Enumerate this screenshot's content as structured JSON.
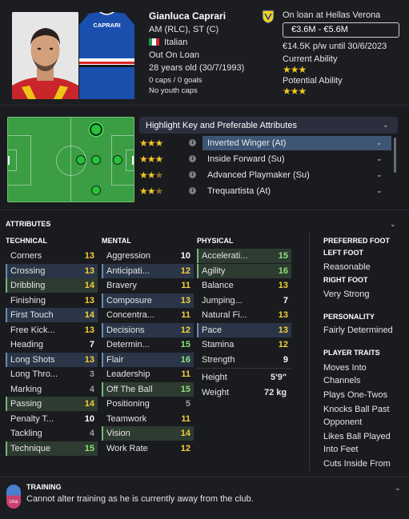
{
  "player": {
    "name": "Gianluca Caprari",
    "positions": "AM (RLC), ST (C)",
    "nationality": "Italian",
    "status": "Out On Loan",
    "age": "28 years old (30/7/1993)",
    "caps": "0 caps / 0 goals",
    "youth": "No youth caps",
    "kit_name": "CAPRARI"
  },
  "contract": {
    "loan": "On loan at Hellas Verona",
    "value": "€3.6M - €5.6M",
    "wage": "€14.5K p/w until 30/6/2023",
    "current_ability_label": "Current Ability",
    "current_ability_stars": 3,
    "potential_ability_label": "Potential Ability",
    "potential_ability_stars": 3
  },
  "roles": {
    "header": "Highlight Key and Preferable Attributes",
    "items": [
      {
        "name": "Inverted Winger (At)",
        "stars": 3
      },
      {
        "name": "Inside Forward (Su)",
        "stars": 3
      },
      {
        "name": "Advanced Playmaker (Su)",
        "stars": 2.5
      },
      {
        "name": "Trequartista (At)",
        "stars": 2.5
      }
    ]
  },
  "attributes": {
    "title": "ATTRIBUTES",
    "technical_label": "TECHNICAL",
    "mental_label": "MENTAL",
    "physical_label": "PHYSICAL",
    "technical": [
      {
        "name": "Corners",
        "value": "13"
      },
      {
        "name": "Crossing",
        "value": "13"
      },
      {
        "name": "Dribbling",
        "value": "14"
      },
      {
        "name": "Finishing",
        "value": "13"
      },
      {
        "name": "First Touch",
        "value": "14"
      },
      {
        "name": "Free Kick...",
        "value": "13"
      },
      {
        "name": "Heading",
        "value": "7"
      },
      {
        "name": "Long Shots",
        "value": "13"
      },
      {
        "name": "Long Thro...",
        "value": "3"
      },
      {
        "name": "Marking",
        "value": "4"
      },
      {
        "name": "Passing",
        "value": "14"
      },
      {
        "name": "Penalty T...",
        "value": "10"
      },
      {
        "name": "Tackling",
        "value": "4"
      },
      {
        "name": "Technique",
        "value": "15"
      }
    ],
    "mental": [
      {
        "name": "Aggression",
        "value": "10"
      },
      {
        "name": "Anticipati...",
        "value": "12"
      },
      {
        "name": "Bravery",
        "value": "11"
      },
      {
        "name": "Composure",
        "value": "13"
      },
      {
        "name": "Concentra...",
        "value": "11"
      },
      {
        "name": "Decisions",
        "value": "12"
      },
      {
        "name": "Determin...",
        "value": "15"
      },
      {
        "name": "Flair",
        "value": "16"
      },
      {
        "name": "Leadership",
        "value": "11"
      },
      {
        "name": "Off The Ball",
        "value": "15"
      },
      {
        "name": "Positioning",
        "value": "5"
      },
      {
        "name": "Teamwork",
        "value": "11"
      },
      {
        "name": "Vision",
        "value": "14"
      },
      {
        "name": "Work Rate",
        "value": "12"
      }
    ],
    "physical": [
      {
        "name": "Accelerati...",
        "value": "15"
      },
      {
        "name": "Agility",
        "value": "16"
      },
      {
        "name": "Balance",
        "value": "13"
      },
      {
        "name": "Jumping...",
        "value": "7"
      },
      {
        "name": "Natural Fi...",
        "value": "13"
      },
      {
        "name": "Pace",
        "value": "13"
      },
      {
        "name": "Stamina",
        "value": "12"
      },
      {
        "name": "Strength",
        "value": "9"
      }
    ],
    "height_label": "Height",
    "height": "5'9\"",
    "weight_label": "Weight",
    "weight": "72 kg"
  },
  "side": {
    "preferred_foot_label": "PREFERRED FOOT",
    "left_foot_label": "LEFT FOOT",
    "left_foot": "Reasonable",
    "right_foot_label": "RIGHT FOOT",
    "right_foot": "Very Strong",
    "personality_label": "PERSONALITY",
    "personality": "Fairly Determined",
    "traits_label": "PLAYER TRAITS",
    "traits": [
      "Moves Into Channels",
      "Plays One-Twos",
      "Knocks Ball Past Opponent",
      "Likes Ball Played Into Feet",
      "Cuts Inside From Left Wing"
    ]
  },
  "training": {
    "label": "TRAINING",
    "text": "Cannot alter training as he is currently away from the club.",
    "badge": "Una"
  }
}
